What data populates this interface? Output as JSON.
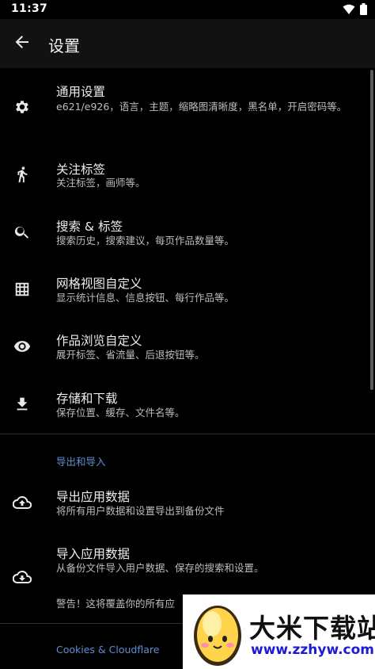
{
  "status": {
    "time": "11:37"
  },
  "appbar": {
    "title": "设置"
  },
  "items": [
    {
      "title": "通用设置",
      "subtitle": "e621/e926，语言，主题，缩略图清晰度，黑名单，开启密码等。",
      "icon": "gear-icon"
    },
    {
      "title": "关注标签",
      "subtitle": "关注标签，画师等。",
      "icon": "walk-icon"
    },
    {
      "title": "搜索 & 标签",
      "subtitle": "搜索历史，搜索建议，每页作品数量等。",
      "icon": "search-icon"
    },
    {
      "title": "网格视图自定义",
      "subtitle": "显示统计信息、信息按钮、每行作品等。",
      "icon": "grid-icon"
    },
    {
      "title": "作品浏览自定义",
      "subtitle": "展开标签、省流量、后退按钮等。",
      "icon": "eye-icon"
    },
    {
      "title": "存储和下载",
      "subtitle": "保存位置、缓存、文件名等。",
      "icon": "download-icon"
    }
  ],
  "section_export": {
    "header": "导出和导入",
    "export_title": "导出应用数据",
    "export_subtitle": "将所有用户数据和设置导出到备份文件",
    "import_title": "导入应用数据",
    "import_subtitle": "从备份文件导入用户数据、保存的搜索和设置。",
    "warning": "警告！这将覆盖你的所有应"
  },
  "section_cookies": {
    "header": "Cookies & Cloudflare"
  },
  "watermark": {
    "main": "大米下载站",
    "url": "www.zzhyw.com"
  },
  "colors": {
    "background": "#000000",
    "appbar": "#121212",
    "accent": "#5f8fd4"
  }
}
